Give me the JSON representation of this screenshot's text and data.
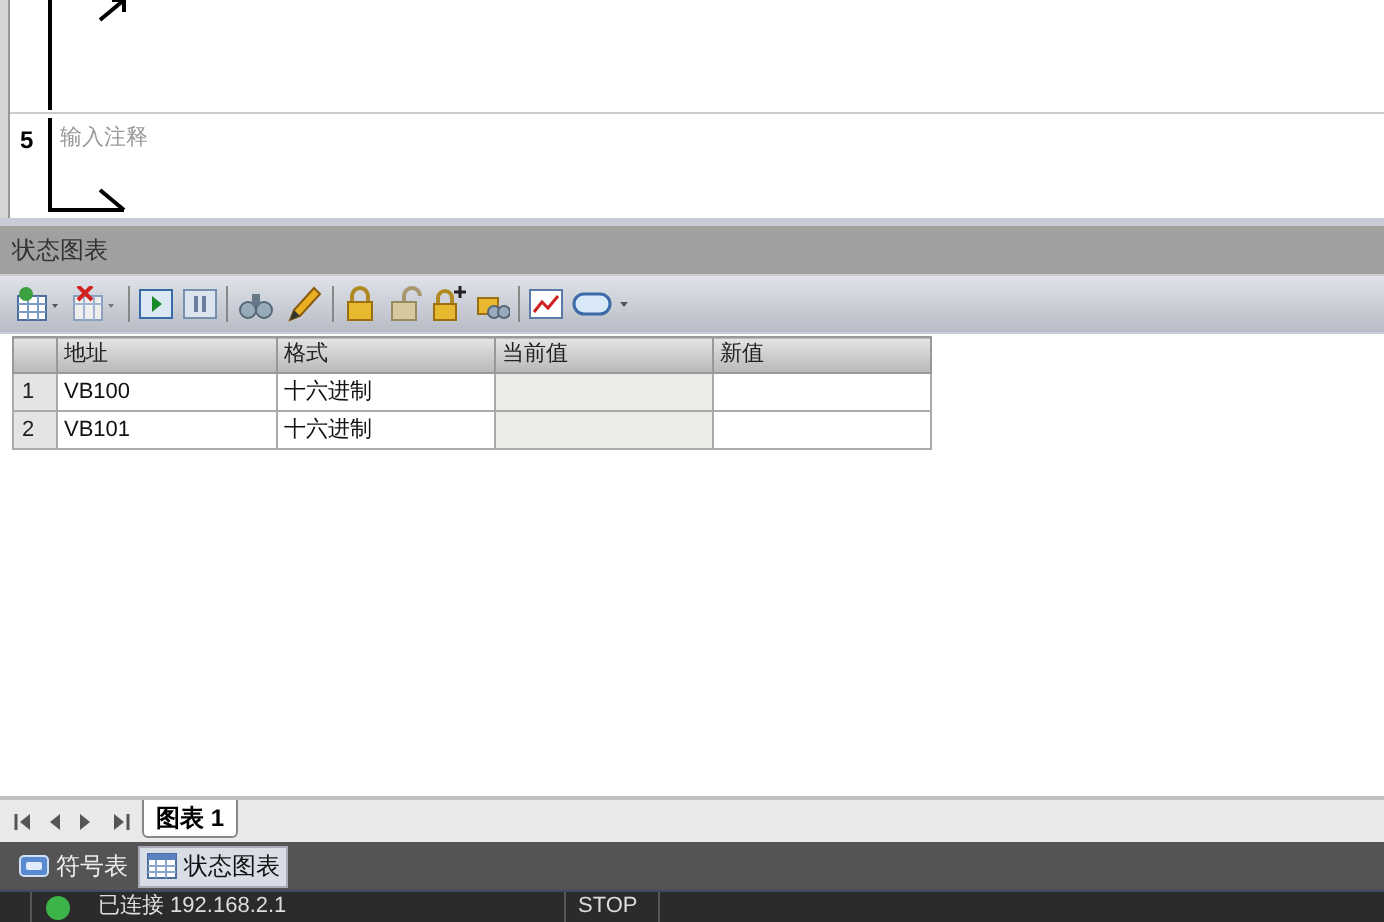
{
  "editor": {
    "rungs": [
      {
        "number": "5",
        "comment": "输入注释"
      }
    ]
  },
  "panel": {
    "title": "状态图表"
  },
  "table": {
    "columns": [
      "地址",
      "格式",
      "当前值",
      "新值"
    ],
    "rows": [
      {
        "number": "1",
        "cells": [
          "VB100",
          "十六进制",
          "",
          ""
        ]
      },
      {
        "number": "2",
        "cells": [
          "VB101",
          "十六进制",
          "",
          ""
        ]
      }
    ]
  },
  "chart_tabs": [
    {
      "label": "图表 1",
      "selected": true
    }
  ],
  "bottom_tabs": [
    {
      "label": "符号表",
      "kind": "symbol",
      "selected": false
    },
    {
      "label": "状态图表",
      "kind": "chart",
      "selected": true
    }
  ],
  "status_bar": {
    "connection": "已连接 192.168.2.1",
    "connected": true,
    "mode": "STOP"
  }
}
